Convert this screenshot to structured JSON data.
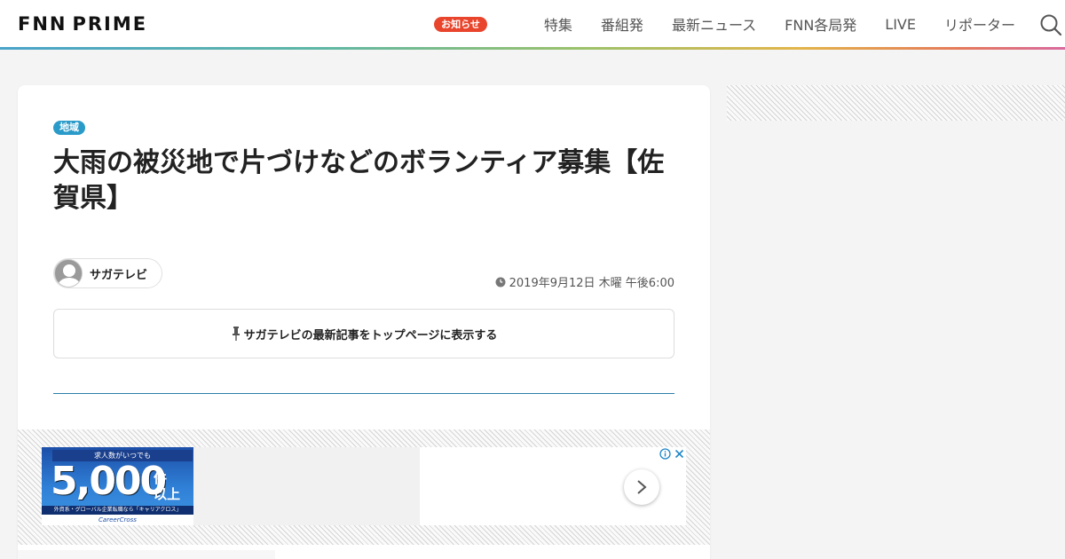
{
  "header": {
    "logo_text": "PRIME",
    "logo_prefix": "FNN",
    "notice_badge": "お知らせ",
    "nav": [
      "特集",
      "番組発",
      "最新ニュース",
      "FNN各局発",
      "LIVE",
      "リポーター"
    ],
    "accent_colors": {
      "badge": "#e8452c",
      "category": "#2a9bc9"
    }
  },
  "article": {
    "category": "地域",
    "title": "大雨の被災地で片づけなどのボランティア募集【佐賀県】",
    "author": "サガテレビ",
    "date": "2019年9月12日 木曜 午後6:00",
    "pin_label": "サガテレビの最新記事をトップページに表示する"
  },
  "ad": {
    "top_label": "求人数がいつでも",
    "big_number": "5,000",
    "unit1": "件",
    "unit2": "以上",
    "sub_label": "外資系・グローバル企業転職なら「キャリアクロス」",
    "brand": "CareerCross"
  }
}
